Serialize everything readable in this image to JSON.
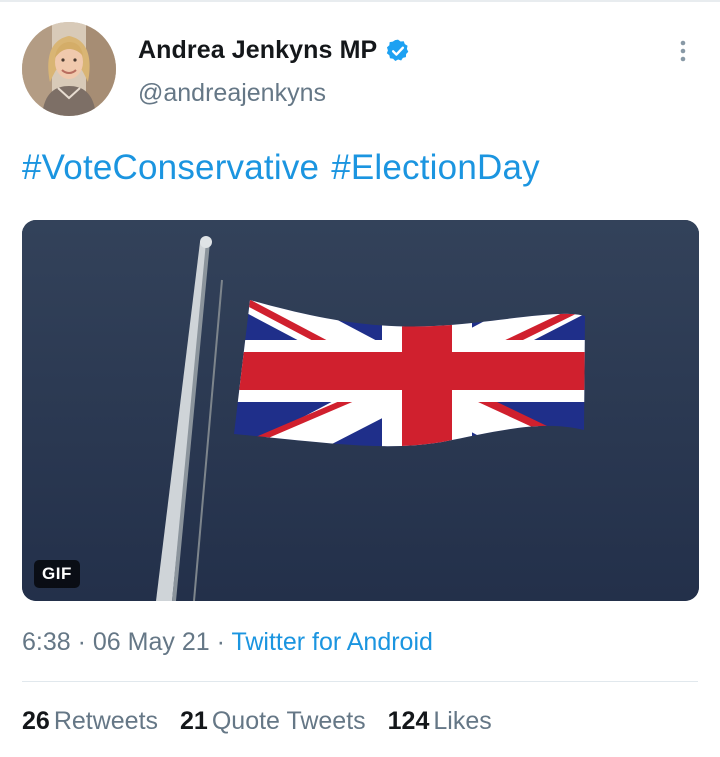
{
  "tweet": {
    "author": {
      "display_name": "Andrea Jenkyns MP",
      "handle": "@andreajenkyns",
      "verified": true,
      "avatar_icon": "profile-photo"
    },
    "text": [
      "#VoteConservative",
      "#ElectionDay"
    ],
    "media": {
      "type": "gif",
      "badge": "GIF",
      "subject_icon": "union-jack-flag"
    },
    "timestamp": {
      "time": "6:38",
      "separator": "·",
      "date": "06 May 21",
      "source": "Twitter for Android"
    },
    "stats": [
      {
        "count": "26",
        "label": "Retweets"
      },
      {
        "count": "21",
        "label": "Quote Tweets"
      },
      {
        "count": "124",
        "label": "Likes"
      }
    ]
  },
  "colors": {
    "link": "#1b95e0",
    "secondary_text": "#657786",
    "primary_text": "#14171a",
    "verified_badge": "#1da1f2"
  }
}
